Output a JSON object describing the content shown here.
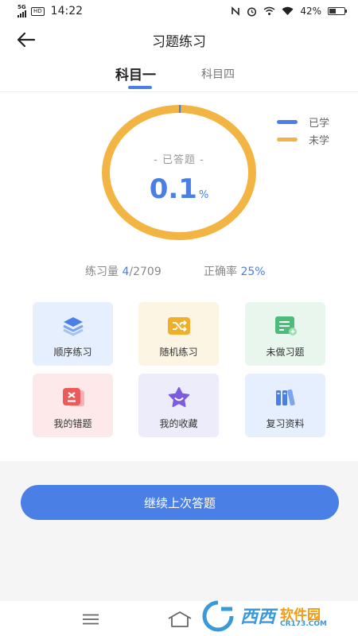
{
  "status_bar": {
    "network": "5G",
    "hd": "HD",
    "time": "14:22",
    "battery": "42%",
    "battery_level": 0.42
  },
  "header": {
    "title": "习题练习"
  },
  "tabs": [
    {
      "label": "科目一",
      "active": true
    },
    {
      "label": "科目四",
      "active": false
    }
  ],
  "legend": [
    {
      "label": "已学",
      "color": "#4a7fe6"
    },
    {
      "label": "未学",
      "color": "#f2b544"
    }
  ],
  "progress": {
    "label": "- 已答题 -",
    "value": "0.1",
    "unit": "%",
    "fraction": 0.001
  },
  "stats": {
    "practice_label": "练习量",
    "practice_done": "4",
    "practice_total": "/2709",
    "accuracy_label": "正确率",
    "accuracy_value": "25%"
  },
  "grid": [
    {
      "label": "顺序练习",
      "icon": "layers-icon",
      "bg": "#e6effd",
      "color": "#4a7fe6"
    },
    {
      "label": "随机练习",
      "icon": "shuffle-icon",
      "bg": "#fdf5e4",
      "color": "#f0ae2c"
    },
    {
      "label": "未做习题",
      "icon": "note-list-icon",
      "bg": "#e8f6ee",
      "color": "#4dbb7a"
    },
    {
      "label": "我的错题",
      "icon": "wrong-answers-icon",
      "bg": "#fde9e9",
      "color": "#ec5a5a"
    },
    {
      "label": "我的收藏",
      "icon": "star-icon",
      "bg": "#ececfb",
      "color": "#7d5be0"
    },
    {
      "label": "复习资料",
      "icon": "books-icon",
      "bg": "#e6effd",
      "color": "#4a7fe6"
    }
  ],
  "continue_button": {
    "label": "继续上次答题"
  },
  "watermark": {
    "brand": "西西",
    "soft": "软件园",
    "domain": "CR173.COM"
  }
}
